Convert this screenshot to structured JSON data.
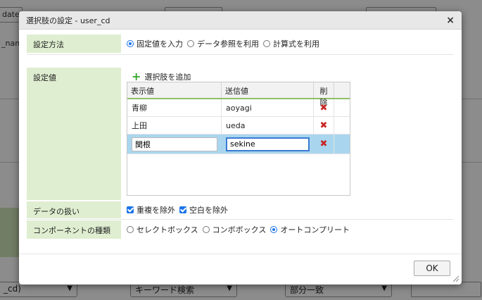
{
  "background": {
    "frag1": "date)",
    "frag2": "_nam",
    "frag3": "_cd)",
    "select_keyword": "キーワード検索",
    "select_partial": "部分一致"
  },
  "dialog": {
    "title": "選択肢の設定 - user_cd",
    "close_icon": "×",
    "method": {
      "label": "設定方法",
      "options": [
        "固定値を入力",
        "データ参照を利用",
        "計算式を利用"
      ],
      "selected": 0
    },
    "values": {
      "label": "設定値",
      "add_label": "選択肢を追加",
      "columns": [
        "表示値",
        "送信値",
        "削除"
      ],
      "rows": [
        {
          "display": "青柳",
          "value": "aoyagi"
        },
        {
          "display": "上田",
          "value": "ueda"
        }
      ],
      "editing": {
        "display": "関根",
        "value": "sekine"
      }
    },
    "handling": {
      "label": "データの扱い",
      "options": [
        "重複を除外",
        "空白を除外"
      ]
    },
    "component": {
      "label": "コンポーネントの種類",
      "options": [
        "セレクトボックス",
        "コンボボックス",
        "オートコンプリート"
      ],
      "selected": 2
    },
    "ok_label": "OK"
  },
  "colors": {
    "label_bg": "#dfeed0",
    "accent": "#1a73e8",
    "selected_row": "#a9d6ee",
    "delete": "#c62828"
  }
}
